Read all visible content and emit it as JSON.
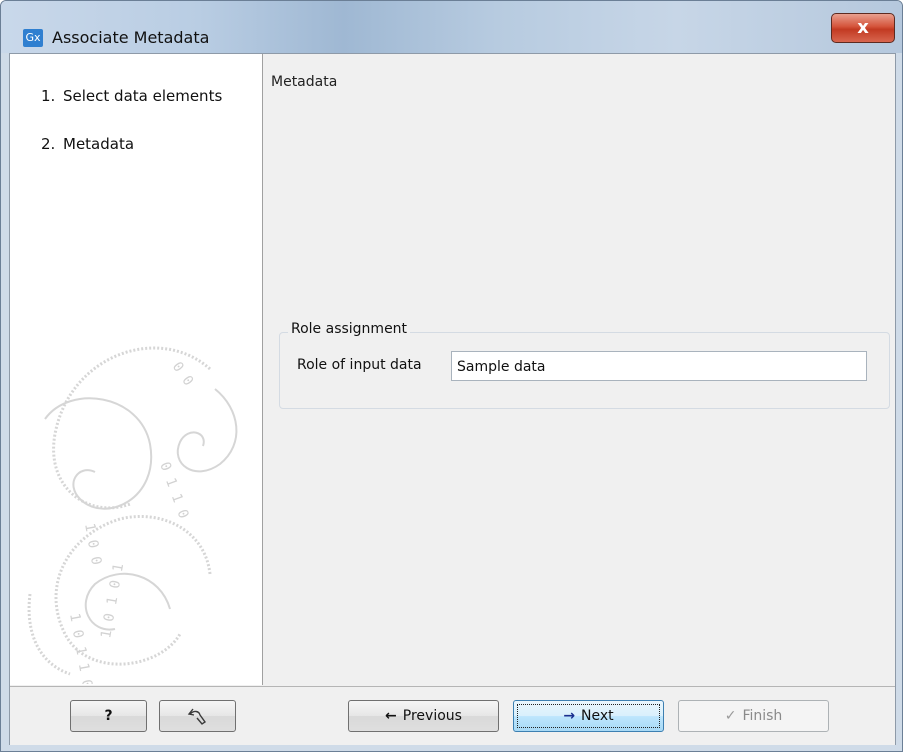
{
  "window": {
    "title": "Associate Metadata",
    "app_icon_text": "Gx",
    "close_glyph": "x"
  },
  "steps": [
    {
      "number": "1.",
      "label": "Select data elements"
    },
    {
      "number": "2.",
      "label": "Metadata"
    }
  ],
  "panel": {
    "title": "Metadata",
    "group": {
      "legend": "Role assignment",
      "role_label": "Role of input data",
      "role_value": "Sample data"
    }
  },
  "buttons": {
    "help": {
      "label": "?"
    },
    "reset": {
      "icon": "reset-icon"
    },
    "previous": {
      "label": "Previous",
      "icon": "arrow-left-icon"
    },
    "next": {
      "label": "Next",
      "icon": "arrow-right-icon"
    },
    "finish": {
      "label": "Finish",
      "icon": "checkmark-icon"
    }
  },
  "colors": {
    "titlebar": "#b9cde3",
    "close_button": "#c94a32",
    "focus_button": "#bee6fd",
    "panel_bg": "#f0f0f0"
  }
}
